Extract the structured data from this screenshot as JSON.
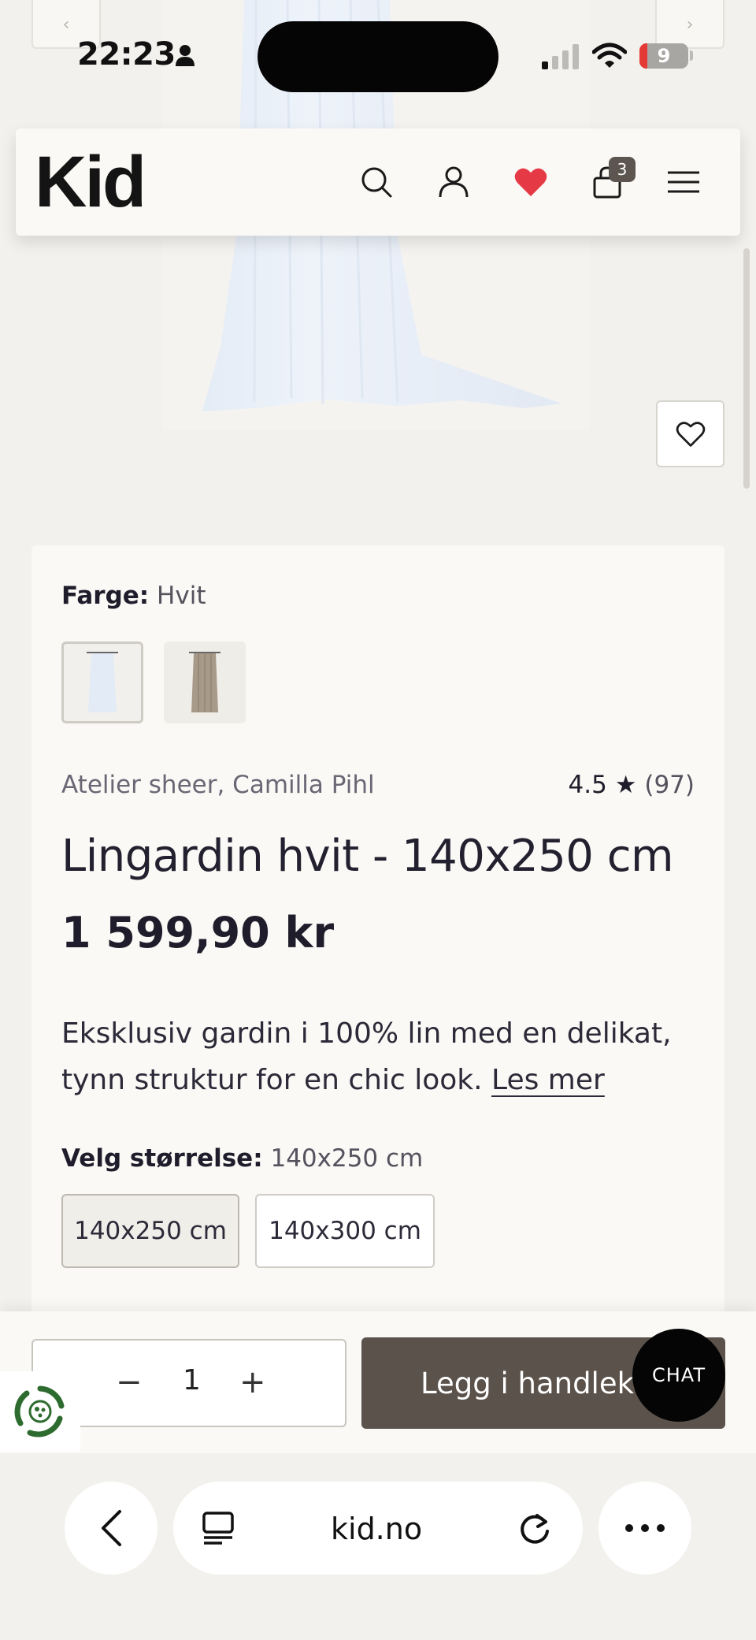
{
  "status_bar": {
    "time": "22:23",
    "battery": "9"
  },
  "header": {
    "logo": "Kid",
    "cart_count": "3"
  },
  "product": {
    "color_label": "Farge:",
    "color_value": "Hvit",
    "brand": "Atelier sheer, Camilla Pihl",
    "rating": "4.5 ★",
    "rating_count": "(97)",
    "title": "Lingardin hvit - 140x250 cm",
    "price": "1 599,90 kr",
    "description": "Eksklusiv gardin i 100% lin med en delikat, tynn struktur for en chic look.",
    "read_more": "Les mer",
    "size_label": "Velg størrelse:",
    "size_value": "140x250 cm",
    "sizes": [
      "140x250 cm",
      "140x300 cm"
    ]
  },
  "purchase": {
    "quantity": "1",
    "minus": "−",
    "plus": "+",
    "add_to_cart": "Legg i handlekurv"
  },
  "chat": {
    "label": "CHAT"
  },
  "browser": {
    "url": "kid.no"
  },
  "colors": {
    "accent": "#5b524b",
    "heart": "#e53945",
    "background": "#f3f1ed",
    "card": "#faf9f5"
  }
}
